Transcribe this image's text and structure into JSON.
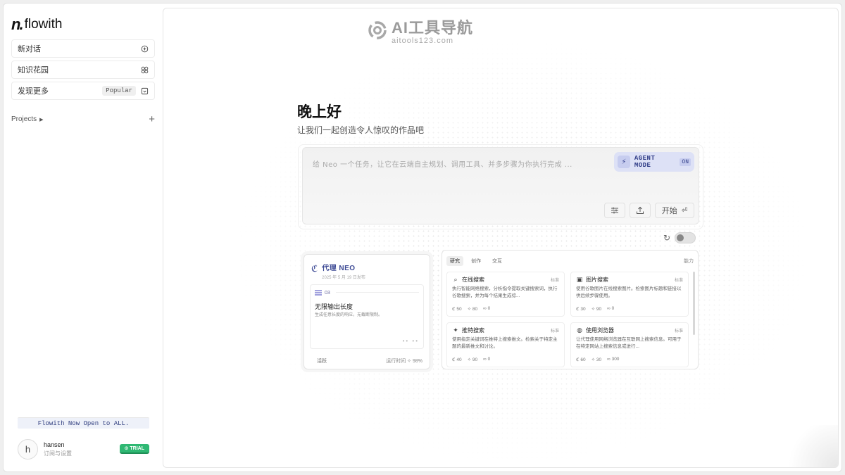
{
  "app": {
    "logo_mark": "n.",
    "logo_text": "flowith"
  },
  "sidebar": {
    "items": [
      {
        "label": "新对话",
        "icon": "new-chat-icon"
      },
      {
        "label": "知识花园",
        "icon": "garden-icon"
      },
      {
        "label": "发现更多",
        "icon": "discover-icon",
        "badge": "Popular"
      }
    ],
    "projects_label": "Projects",
    "announcement": "Flowith Now Open to ALL.",
    "user": {
      "initial": "h",
      "name": "hansen",
      "subtitle": "订阅与设置",
      "badge": "TRIAL"
    }
  },
  "watermark": {
    "title": "AI工具导航",
    "subtitle": "aitools123.com"
  },
  "main": {
    "greeting": "晚上好",
    "subtitle": "让我们一起创造令人惊叹的作品吧",
    "composer": {
      "placeholder": "给 Neo 一个任务，让它在云端自主规划、调用工具、并多步骤为你执行完成 ...",
      "agent_mode_label": "AGENT MODE",
      "agent_mode_state": "ON",
      "start_label": "开始"
    },
    "agent_card": {
      "title": "代理 NEO",
      "date": "2025 年 5 月 19 日发布",
      "item_number": "03",
      "item_title": "无限输出长度",
      "item_desc": "生成任意长度的响应，无截断限制。",
      "status": "活跃",
      "runtime_label": "运行时间",
      "runtime_value": "98%"
    },
    "tools": {
      "tabs": [
        "研究",
        "创作",
        "交互"
      ],
      "capability_label": "能力",
      "cards": [
        {
          "name": "在线搜索",
          "tag": "标准",
          "icon": "search-icon",
          "desc": "执行智能网络搜索，分析指令提取关键搜索词，执行谷歌搜索，并为每个结果生成综...",
          "s1": "50",
          "s2": "80",
          "s3": "0"
        },
        {
          "name": "图片搜索",
          "tag": "标准",
          "icon": "image-icon",
          "desc": "使用谷歌图片在线搜索图片。检索图片标题和链接以供后续步骤使用。",
          "s1": "30",
          "s2": "90",
          "s3": "0"
        },
        {
          "name": "推特搜索",
          "tag": "标准",
          "icon": "twitter-icon",
          "desc": "使用指定关键词在推特上搜索推文。检索关于特定主题的最新推文和讨论。",
          "s1": "40",
          "s2": "90",
          "s3": "0"
        },
        {
          "name": "使用浏览器",
          "tag": "标准",
          "icon": "globe-icon",
          "desc": "让代理使用网络浏览器在互联网上搜索信息。可用于在特定网站上搜索信息或进行...",
          "s1": "60",
          "s2": "30",
          "s3": "300"
        }
      ]
    }
  }
}
